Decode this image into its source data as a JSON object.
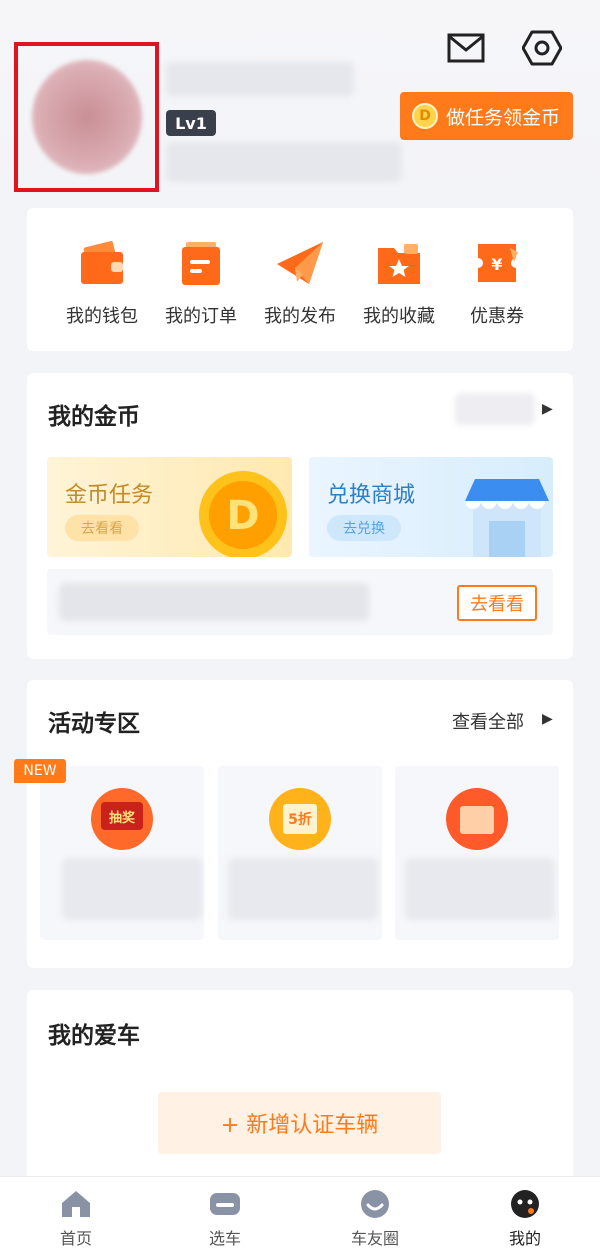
{
  "profile": {
    "level": "Lv1",
    "task_button": "做任务领金币",
    "coin_symbol": "D"
  },
  "shortcuts": [
    {
      "label": "我的钱包",
      "icon": "wallet-icon"
    },
    {
      "label": "我的订单",
      "icon": "order-icon"
    },
    {
      "label": "我的发布",
      "icon": "paper-plane-icon"
    },
    {
      "label": "我的收藏",
      "icon": "star-folder-icon"
    },
    {
      "label": "优惠券",
      "icon": "coupon-icon"
    }
  ],
  "coins": {
    "title": "我的金币",
    "promos": [
      {
        "title": "金币任务",
        "pill": "去看看"
      },
      {
        "title": "兑换商城",
        "pill": "去兑换"
      }
    ],
    "go_button": "去看看"
  },
  "activity": {
    "title": "活动专区",
    "view_all": "查看全部",
    "new_tag": "NEW",
    "tiles": [
      {
        "icon": "lottery-icon",
        "icon_text": "抽奖"
      },
      {
        "icon": "discount-icon",
        "icon_text": "5折"
      },
      {
        "icon": "red-envelope-icon",
        "icon_text": ""
      }
    ]
  },
  "car": {
    "title": "我的爱车",
    "add_button": "+ 新增认证车辆"
  },
  "tabbar": [
    {
      "label": "首页",
      "icon": "home-icon"
    },
    {
      "label": "选车",
      "icon": "car-icon"
    },
    {
      "label": "车友圈",
      "icon": "smile-icon"
    },
    {
      "label": "我的",
      "icon": "profile-icon"
    }
  ],
  "colors": {
    "accent": "#ff7a1a",
    "highlight_frame": "#e0141f",
    "badge": "#3a3f4c"
  }
}
